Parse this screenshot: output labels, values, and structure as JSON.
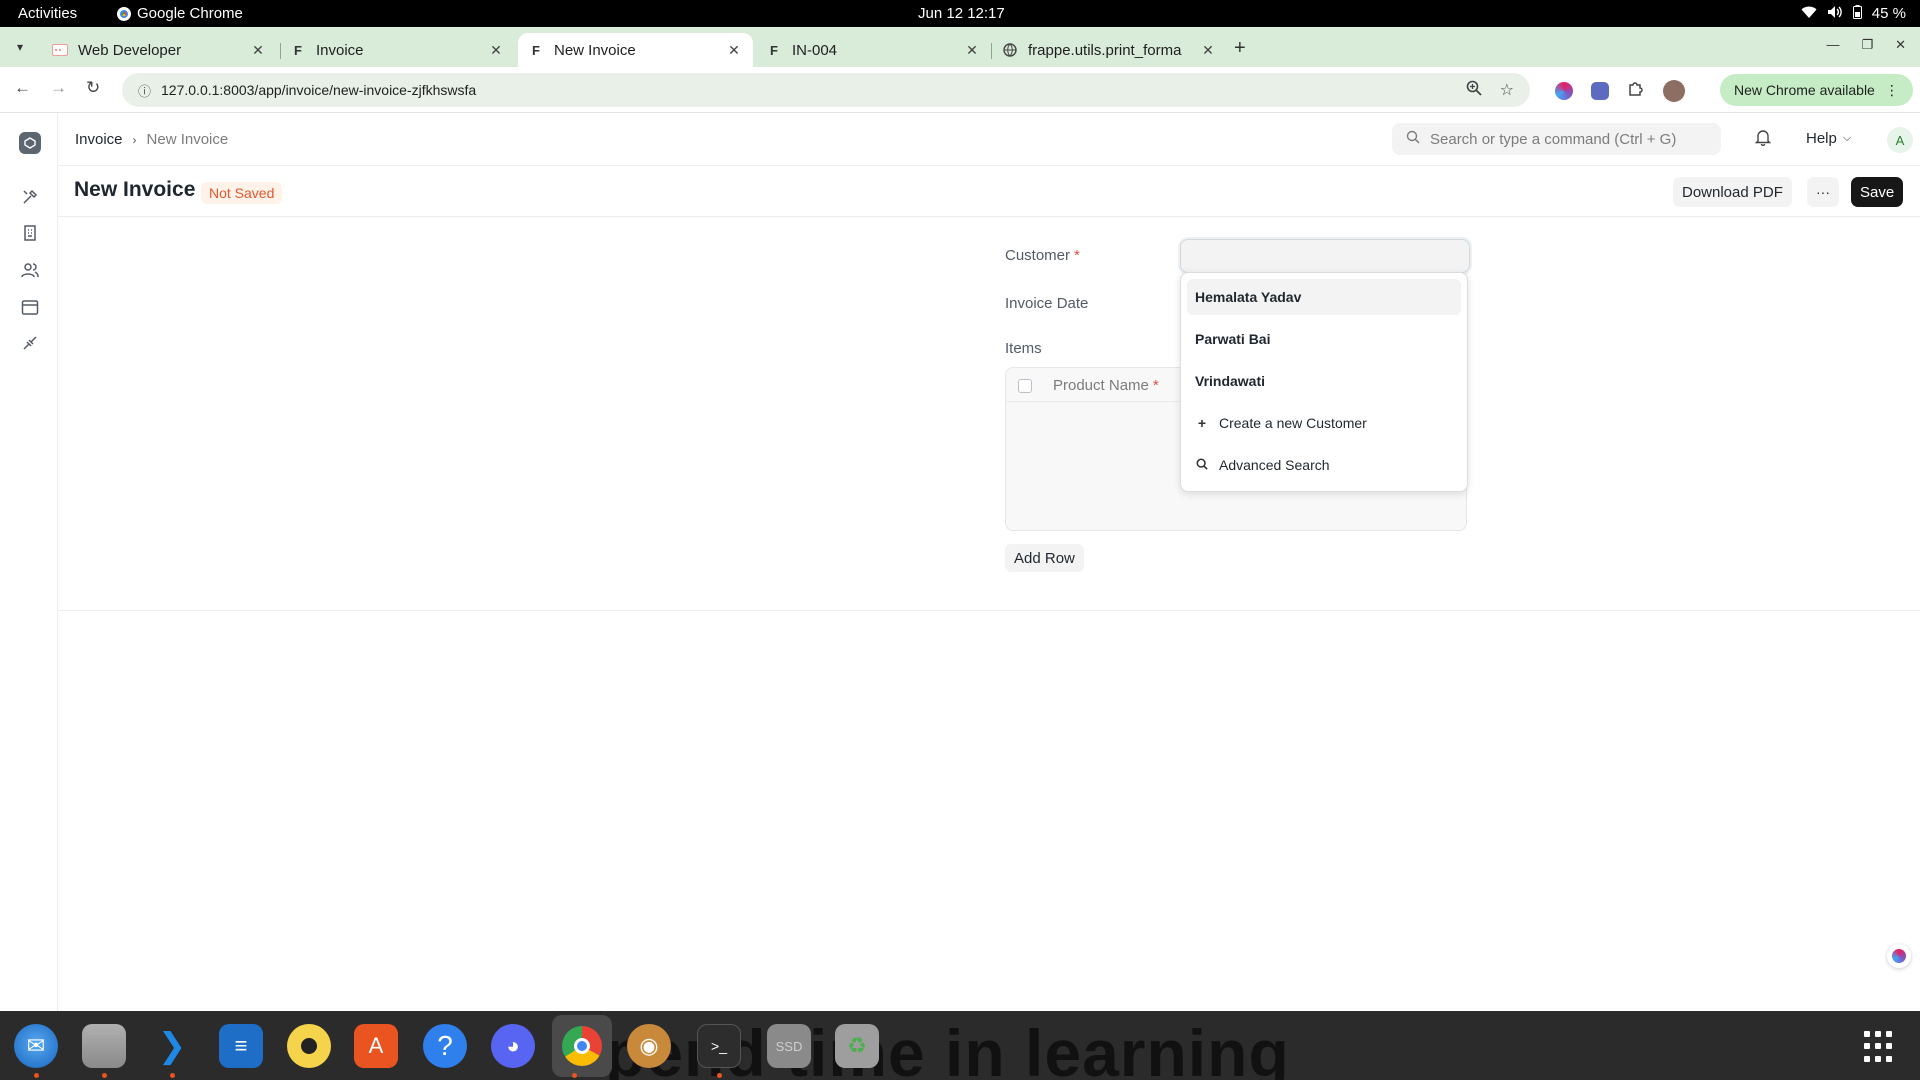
{
  "system_bar": {
    "activities": "Activities",
    "app_name": "Google Chrome",
    "clock": "Jun 12  12:17",
    "battery": "45 %"
  },
  "browser": {
    "tabs": [
      {
        "title": "Web Developer",
        "active": false
      },
      {
        "title": "Invoice",
        "active": false
      },
      {
        "title": "New Invoice",
        "active": true
      },
      {
        "title": "IN-004",
        "active": false
      },
      {
        "title": "frappe.utils.print_forma",
        "active": false
      }
    ],
    "url": "127.0.0.1:8003/app/invoice/new-invoice-zjfkhswsfa",
    "update_button": "New Chrome available"
  },
  "navbar": {
    "breadcrumb": [
      "Invoice",
      "New Invoice"
    ],
    "search_placeholder": "Search or type a command (Ctrl + G)",
    "help": "Help",
    "avatar_initial": "A"
  },
  "page": {
    "title": "New Invoice",
    "status": "Not Saved",
    "actions": {
      "download_pdf": "Download PDF",
      "more": "···",
      "save": "Save"
    }
  },
  "form": {
    "customer_label": "Customer",
    "required_mark": "*",
    "customer_value": "",
    "invoice_date_label": "Invoice Date",
    "items_label": "Items",
    "items_columns": [
      "Product Name"
    ],
    "add_row": "Add Row"
  },
  "customer_dropdown": {
    "options": [
      "Hemalata Yadav",
      "Parwati Bai",
      "Vrindawati"
    ],
    "highlighted_index": 0,
    "create_new": "Create a new Customer",
    "advanced_search": "Advanced Search"
  },
  "dock": {
    "wallpaper_text": "Spend time in learning",
    "apps": [
      "thunderbird",
      "files",
      "vscode",
      "text-editor",
      "rhythmbox",
      "app-center",
      "help",
      "discord",
      "chrome",
      "gimp",
      "terminal",
      "ssd",
      "trash"
    ]
  },
  "colors": {
    "tab_strip": "#d9ebd9",
    "status_badge": "#e4572e",
    "save_button": "#171717",
    "required": "#e24c4c"
  }
}
